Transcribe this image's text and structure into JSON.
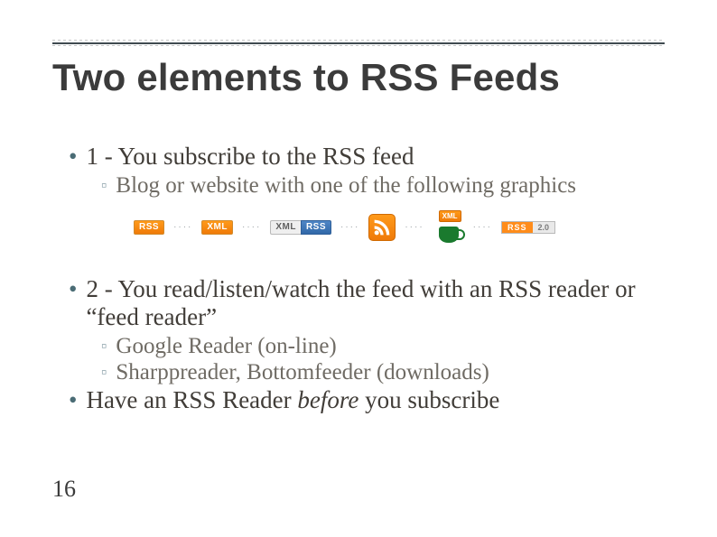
{
  "title": "Two elements to RSS Feeds",
  "bullets": {
    "item1": {
      "text": "1 - You subscribe to the RSS feed",
      "sub1": "Blog or website with one of the following graphics"
    },
    "item2": {
      "text": "2 - You read/listen/watch the feed with an RSS reader or “feed reader”",
      "sub1": "Google Reader (on-line)",
      "sub2": "Sharppreader, Bottomfeeder (downloads)"
    },
    "item3": {
      "prefix": "Have an RSS Reader ",
      "italic": "before",
      "suffix": " you subscribe"
    }
  },
  "icons": {
    "rss_label": "RSS",
    "xml_label": "XML",
    "rss20_left": "RSS",
    "rss20_right": "2.0",
    "cup_flag": "XML"
  },
  "page_number": "16"
}
